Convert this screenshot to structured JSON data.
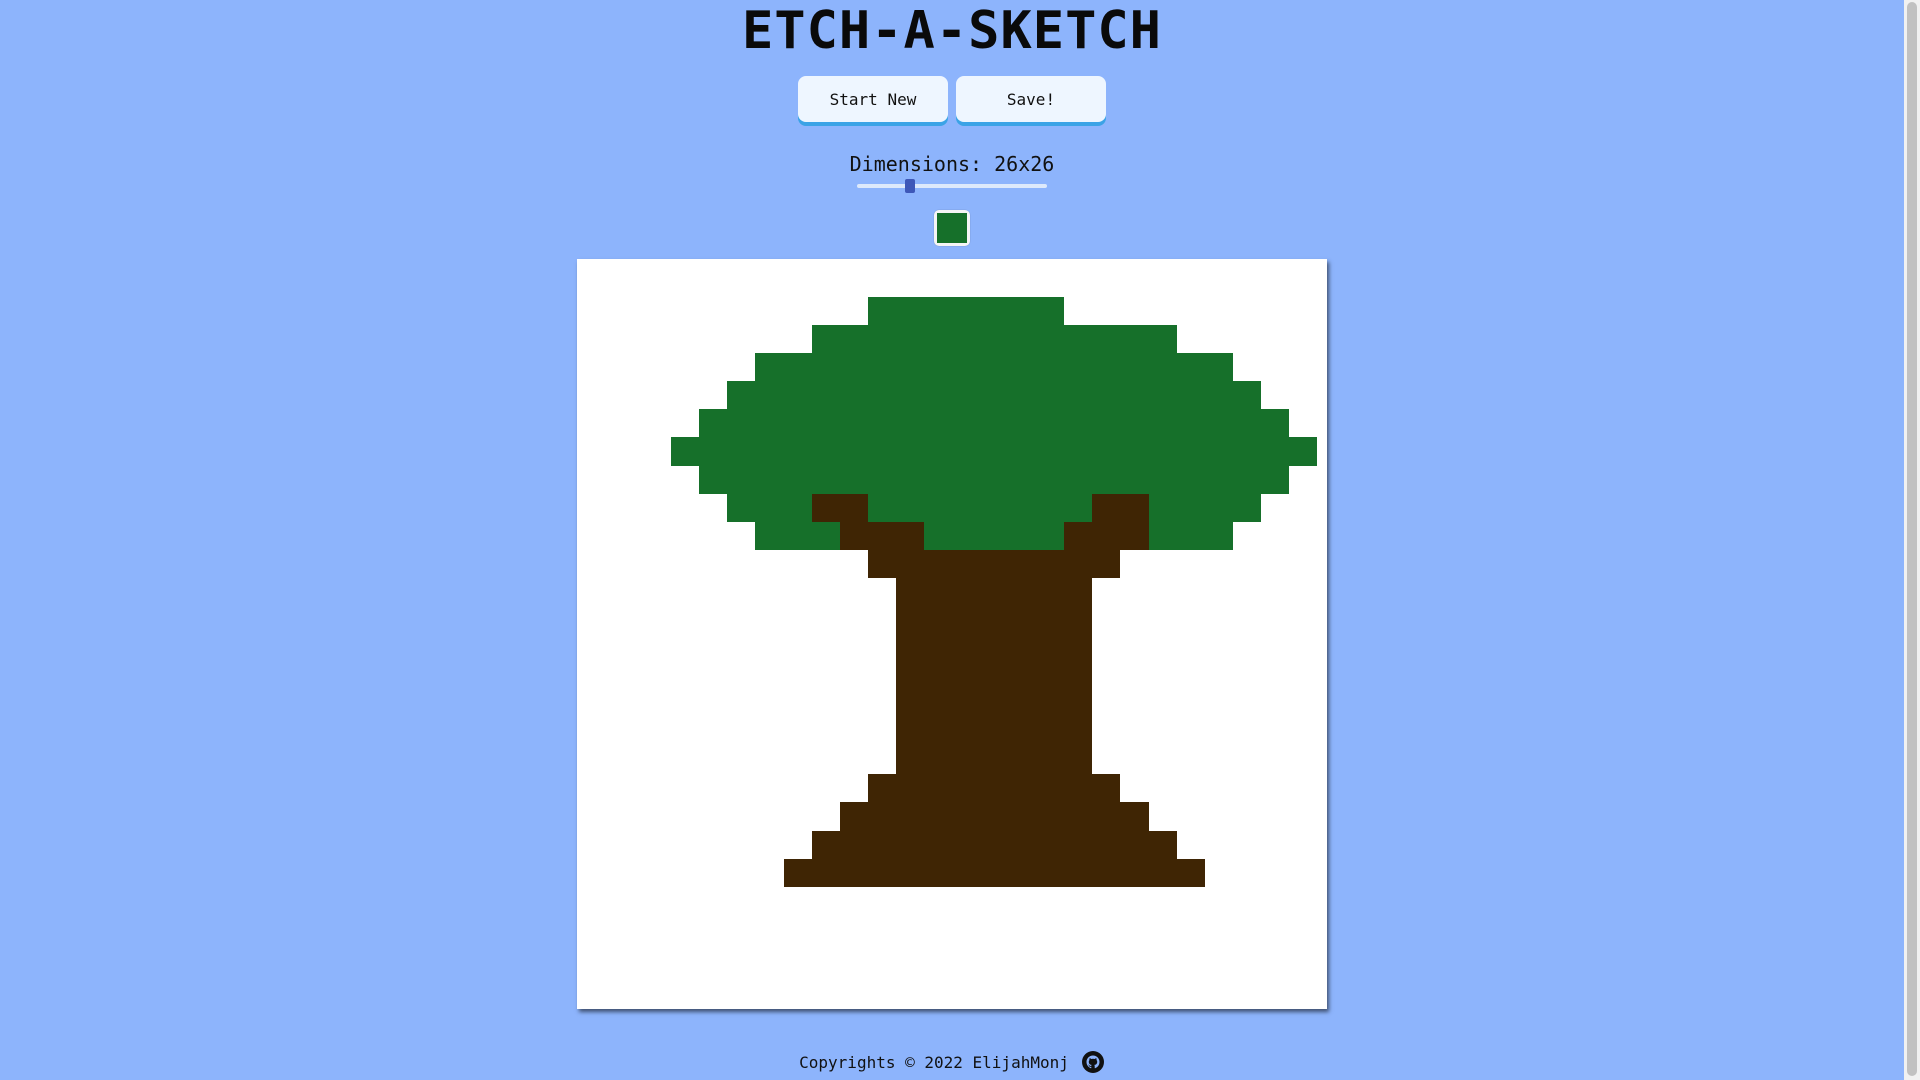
{
  "title": "ETCH-A-SKETCH",
  "buttons": {
    "start_new": "Start New",
    "save": "Save!"
  },
  "dimensions": {
    "label": "Dimensions: 26x26",
    "size": 26,
    "min": 2,
    "max": 100
  },
  "color_picker": {
    "value": "#16702a"
  },
  "palette": {
    ".": "#ffffff",
    "G": "#16702a",
    "B": "#3f2504"
  },
  "pixel_rows": [
    "..........................",
    "..........GGGGGGG.........",
    "........GGGGGGGGGGGGG.....",
    "......GGGGGGGGGGGGGGGGG...",
    ".....GGGGGGGGGGGGGGGGGGG..",
    "....GGGGGGGGGGGGGGGGGGGGG.",
    "...GGGGGGGGGGGGGGGGGGGGGGG",
    "....GGGGGGGGGGGGGGGGGGGGG.",
    ".....GGGBBGGGGGGGGBBGGGG..",
    "......GGGBBBGGGGGBBBGGG...",
    "..........BBBBBBBBB.......",
    "...........BBBBBBB........",
    "...........BBBBBBB........",
    "...........BBBBBBB........",
    "...........BBBBBBB........",
    "...........BBBBBBB........",
    "...........BBBBBBB........",
    "...........BBBBBBB........",
    "..........BBBBBBBBB.......",
    ".........BBBBBBBBBBB......",
    "........BBBBBBBBBBBBB.....",
    ".......BBBBBBBBBBBBBBB....",
    "..........................",
    "..........................",
    "..........................",
    ".........................."
  ],
  "footer": {
    "text": "Copyrights © 2022 ElijahMonj"
  }
}
